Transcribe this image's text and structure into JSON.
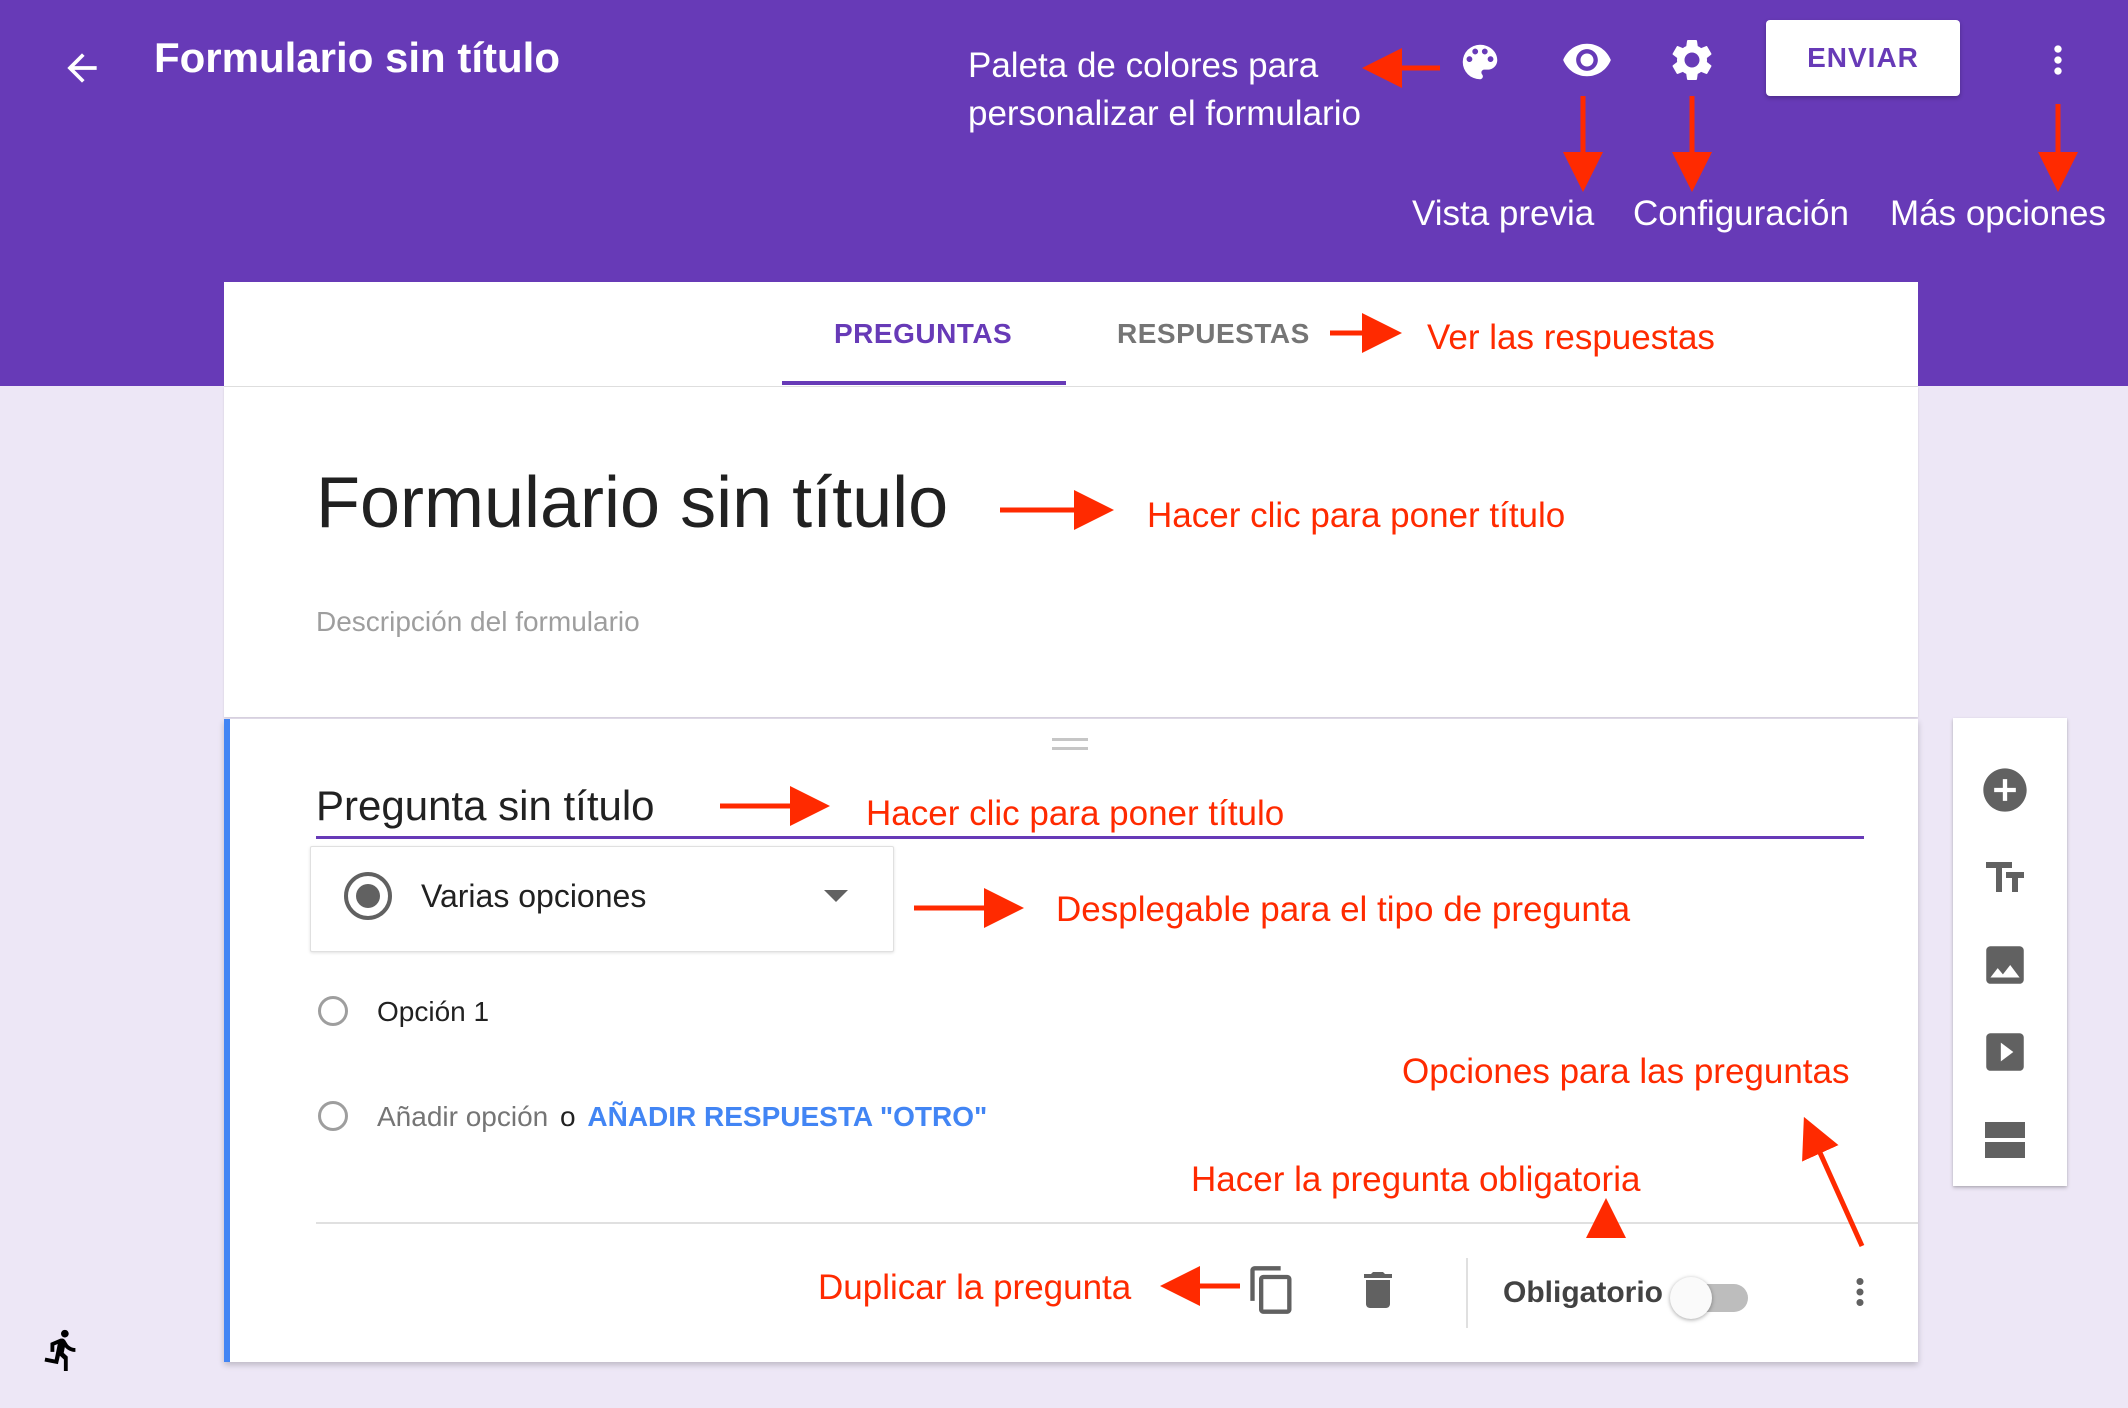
{
  "header": {
    "back_icon": "arrow-back-icon",
    "title": "Formulario sin título",
    "send_label": "ENVIAR",
    "palette_icon": "palette-icon",
    "preview_icon": "eye-icon",
    "settings_icon": "gear-icon",
    "more_icon": "more-vert-icon"
  },
  "annotations": {
    "palette_line1": "Paleta de colores para",
    "palette_line2": "personalizar el formulario",
    "preview": "Vista previa",
    "settings": "Configuración",
    "more": "Más opciones",
    "responses": "Ver las respuestas",
    "form_title": "Hacer clic para poner título",
    "question_title": "Hacer clic para poner título",
    "question_type": "Desplegable para el tipo de pregunta",
    "question_options": "Opciones para las preguntas",
    "required": "Hacer la pregunta obligatoria",
    "duplicate": "Duplicar la pregunta"
  },
  "tabs": {
    "questions": "PREGUNTAS",
    "responses": "RESPUESTAS"
  },
  "form": {
    "title": "Formulario sin título",
    "description_placeholder": "Descripción del formulario"
  },
  "question": {
    "title": "Pregunta sin título",
    "type": "Varias opciones",
    "option1": "Opción 1",
    "add_option": "Añadir opción",
    "or": "o",
    "add_other": "AÑADIR RESPUESTA \"OTRO\"",
    "required_label": "Obligatorio",
    "required": false
  },
  "sidebar": {
    "items": [
      "add-question-icon",
      "title-text-icon",
      "image-icon",
      "video-icon",
      "section-icon"
    ]
  },
  "colors": {
    "primary": "#673ab7",
    "annotation": "#ff2a00",
    "link": "#4285f4",
    "focus_bar": "#4285f4"
  }
}
